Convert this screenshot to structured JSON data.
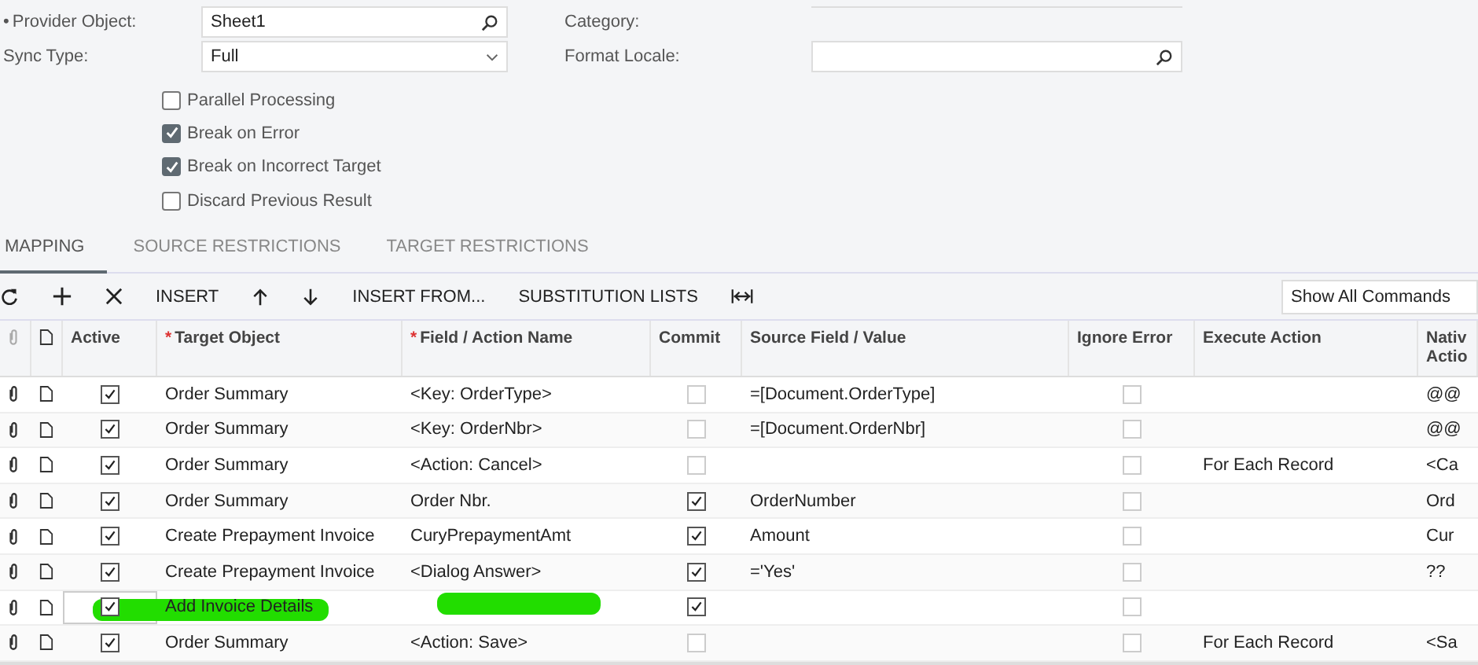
{
  "form": {
    "left": [
      {
        "label": "Provider Object:",
        "marker": "•",
        "value": "Sheet1",
        "kind": "lookup"
      },
      {
        "label": "Sync Type:",
        "value": "Full",
        "kind": "select"
      }
    ],
    "right": [
      {
        "label": "Category:"
      },
      {
        "label": "Format Locale:",
        "kind": "lookup"
      }
    ],
    "options": [
      {
        "label": "Parallel Processing",
        "checked": false
      },
      {
        "label": "Break on Error",
        "checked": true
      },
      {
        "label": "Break on Incorrect Target",
        "checked": true
      },
      {
        "label": "Discard Previous Result",
        "checked": false
      }
    ]
  },
  "tabs": [
    {
      "label": "MAPPING",
      "selected": true
    },
    {
      "label": "SOURCE RESTRICTIONS",
      "selected": false
    },
    {
      "label": "TARGET RESTRICTIONS",
      "selected": false
    }
  ],
  "toolbar": {
    "buttons": [
      {
        "kind": "refresh"
      },
      {
        "kind": "add"
      },
      {
        "kind": "delete"
      },
      {
        "kind": "text",
        "label": "INSERT"
      },
      {
        "kind": "up"
      },
      {
        "kind": "down"
      },
      {
        "kind": "text",
        "label": "INSERT FROM..."
      },
      {
        "kind": "text",
        "label": "SUBSTITUTION LISTS"
      },
      {
        "kind": "fit"
      }
    ],
    "commands": "Show All Commands"
  },
  "table": {
    "columns": [
      {
        "label": "Active"
      },
      {
        "label": "Target Object",
        "marker": "*"
      },
      {
        "label": "Field / Action Name",
        "marker": "*"
      },
      {
        "label": "Commit"
      },
      {
        "label": "Source Field / Value"
      },
      {
        "label": "Ignore Error"
      },
      {
        "label": "Execute Action"
      },
      {
        "label": "Nativ Actio"
      }
    ],
    "rows": [
      {
        "active": true,
        "target": "Order Summary",
        "field": "<Key: OrderType>",
        "commit": false,
        "source": "=[Document.OrderType]",
        "ignore_error": false,
        "execute": "",
        "native": "@@",
        "highlighted": false
      },
      {
        "active": true,
        "target": "Order Summary",
        "field": "<Key: OrderNbr>",
        "commit": false,
        "source": "=[Document.OrderNbr]",
        "ignore_error": false,
        "execute": "",
        "native": "@@",
        "highlighted": false
      },
      {
        "active": true,
        "target": "Order Summary",
        "field": "<Action: Cancel>",
        "commit": false,
        "source": "",
        "ignore_error": false,
        "execute": "For Each Record",
        "native": "<Ca",
        "highlighted": false
      },
      {
        "active": true,
        "target": "Order Summary",
        "field": "Order Nbr.",
        "commit": true,
        "source": "OrderNumber",
        "ignore_error": false,
        "execute": "",
        "native": "Ord",
        "highlighted": false
      },
      {
        "active": true,
        "target": "Create Prepayment Invoice",
        "field": "CuryPrepaymentAmt",
        "commit": true,
        "source": "Amount",
        "ignore_error": false,
        "execute": "",
        "native": "Cur",
        "highlighted": false
      },
      {
        "active": true,
        "target": "Create Prepayment Invoice",
        "field": "<Dialog Answer>",
        "commit": true,
        "source": "='Yes'",
        "ignore_error": false,
        "execute": "",
        "native": "??",
        "highlighted": false
      },
      {
        "active": true,
        "target": "Add Invoice Details",
        "field": "",
        "commit": true,
        "source": "",
        "ignore_error": false,
        "execute": "",
        "native": "",
        "highlighted": true
      },
      {
        "active": true,
        "target": "Order Summary",
        "field": "<Action: Save>",
        "commit": false,
        "source": "",
        "ignore_error": false,
        "execute": "For Each Record",
        "native": "<Sa",
        "highlighted": false
      }
    ]
  }
}
